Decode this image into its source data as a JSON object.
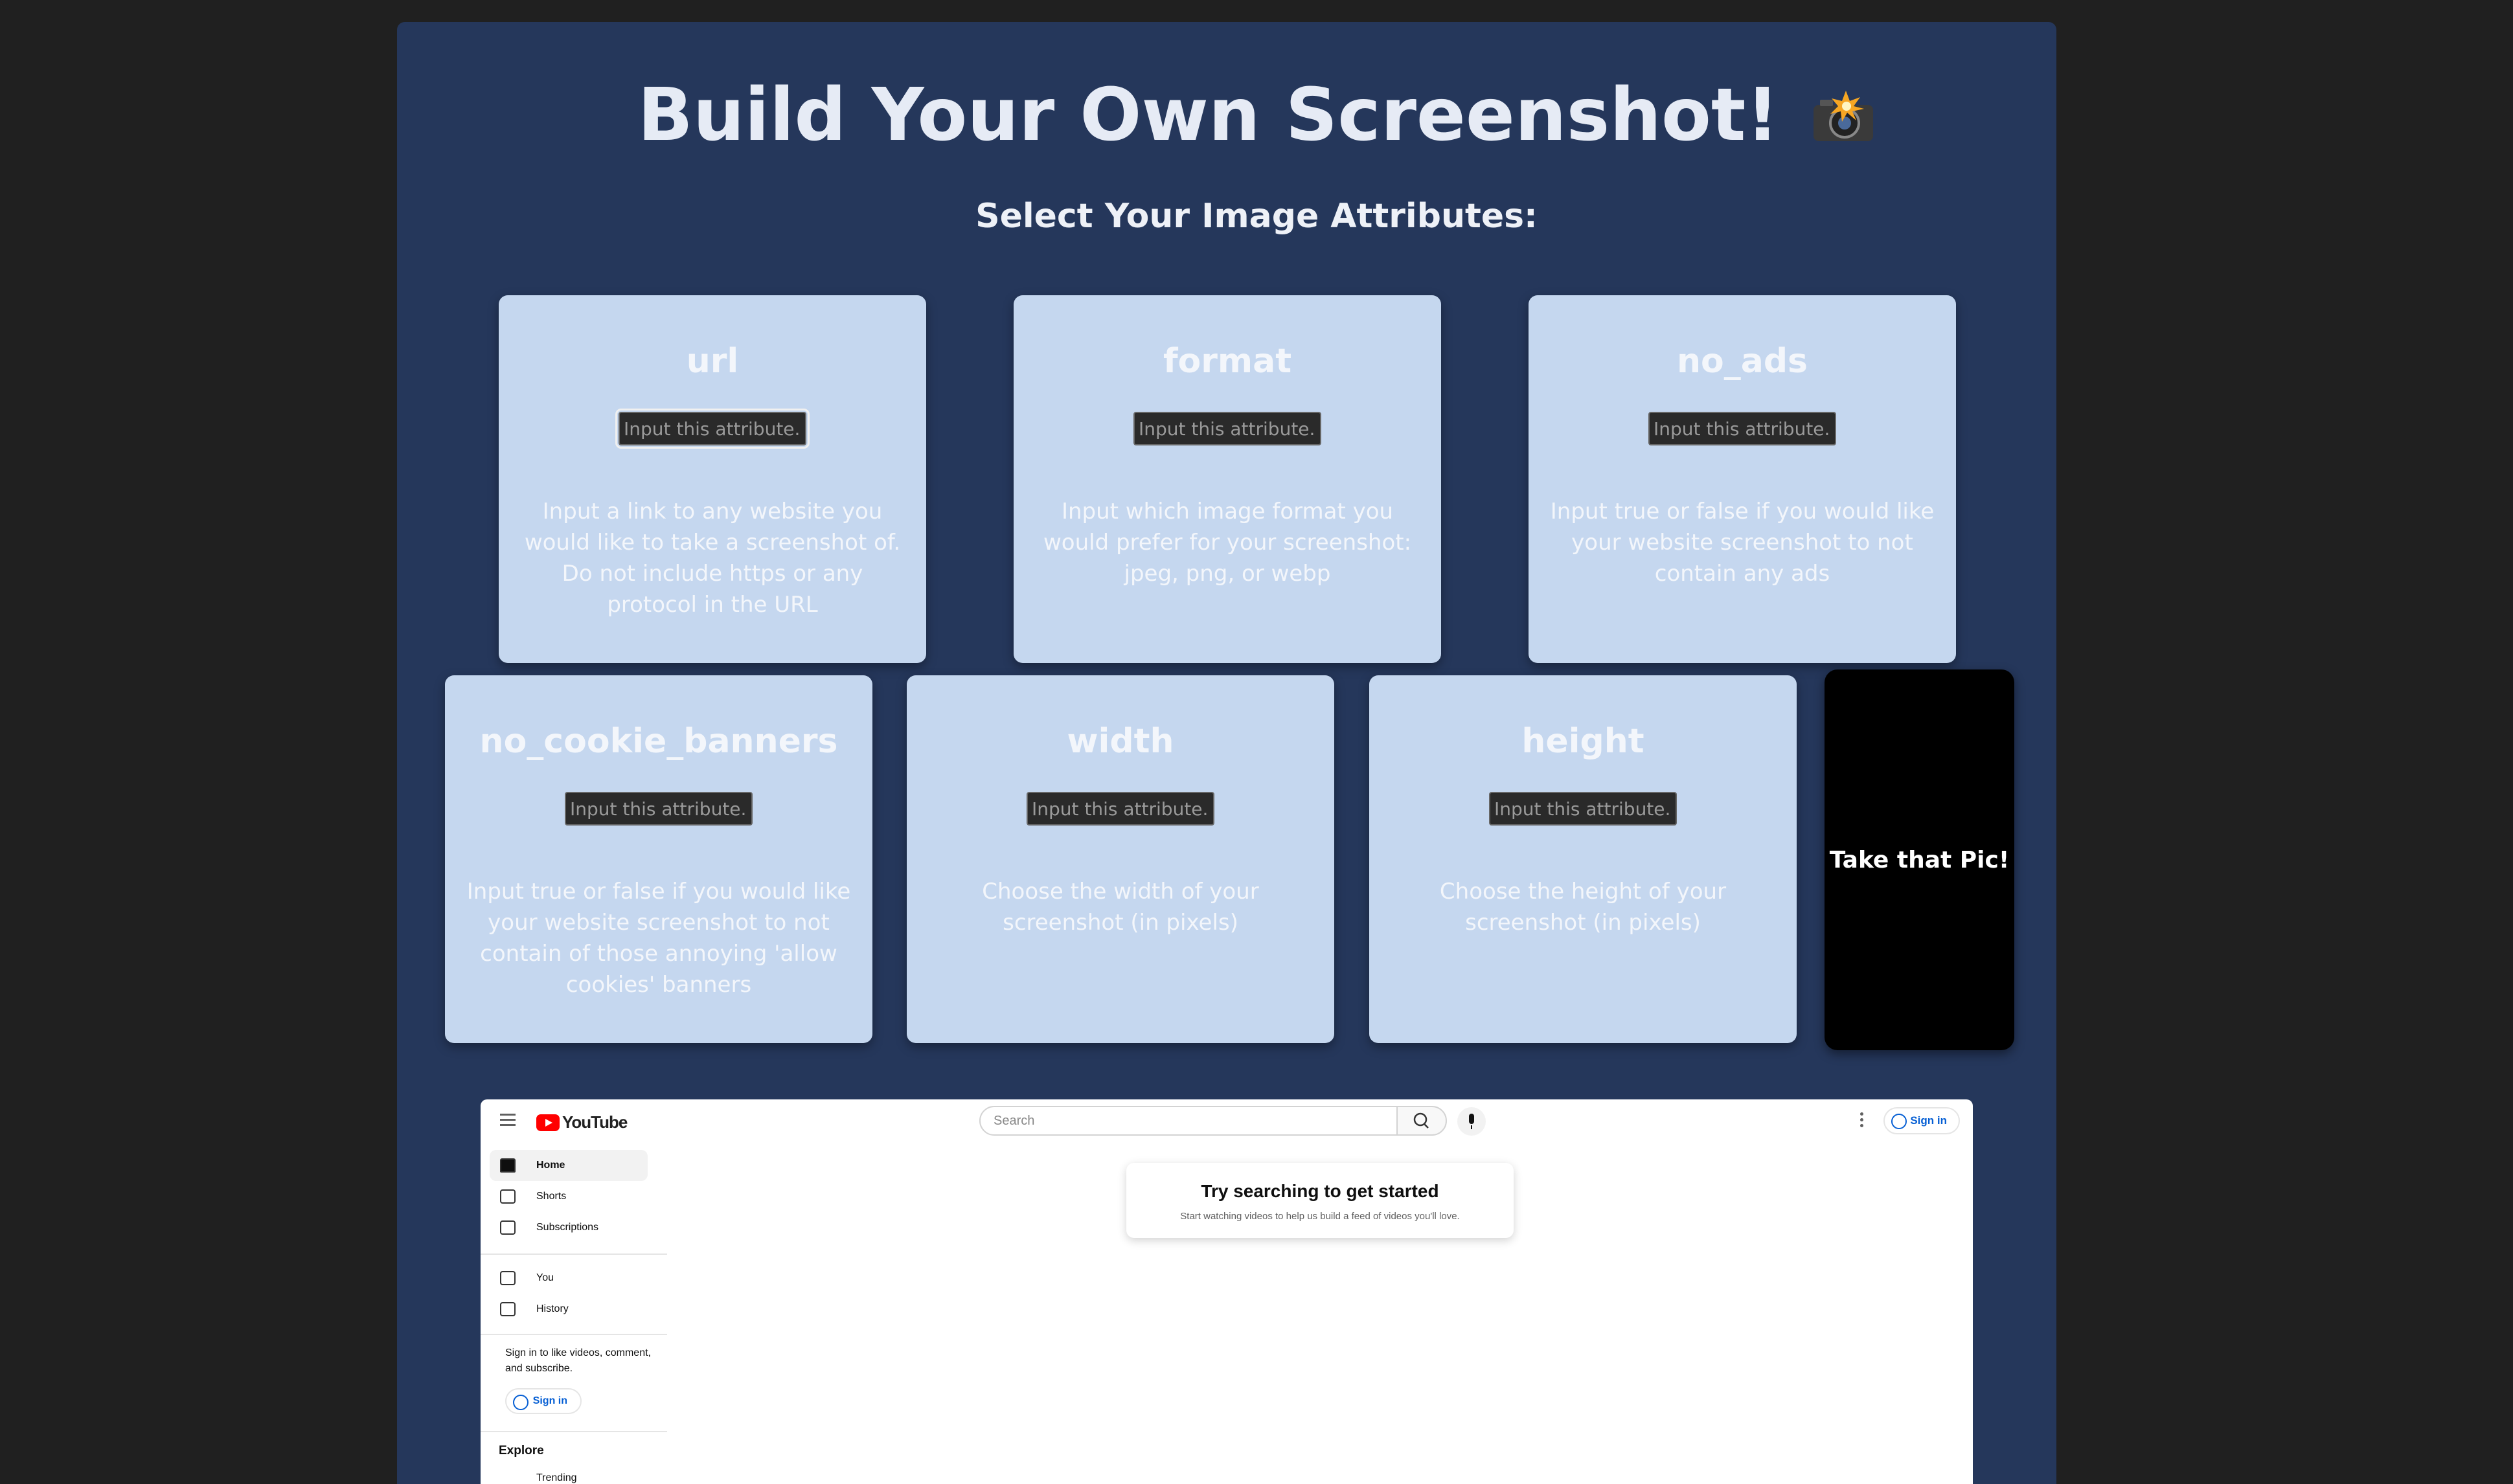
{
  "page": {
    "title": "Build Your Own Screenshot!",
    "subtitle": "Select Your Image Attributes:"
  },
  "cards": [
    {
      "name": "url",
      "placeholder": "Input this attribute...",
      "description": "Input a link to any website you would like to take a screenshot of. Do not include https or any protocol in the URL"
    },
    {
      "name": "format",
      "placeholder": "Input this attribute...",
      "description": "Input which image format you would prefer for your screenshot: jpeg, png, or webp"
    },
    {
      "name": "no_ads",
      "placeholder": "Input this attribute...",
      "description": "Input true or false if you would like your website screenshot to not contain any ads"
    },
    {
      "name": "no_cookie_banners",
      "placeholder": "Input this attribute...",
      "description": "Input true or false if you would like your website screenshot to not contain of those annoying 'allow cookies' banners"
    },
    {
      "name": "width",
      "placeholder": "Input this attribute...",
      "description": "Choose the width of your screenshot (in pixels)"
    },
    {
      "name": "height",
      "placeholder": "Input this attribute...",
      "description": "Choose the height of your screenshot (in pixels)"
    }
  ],
  "action": {
    "label": "Take that Pic!"
  },
  "preview": {
    "logo_text": "YouTube",
    "search_placeholder": "Search",
    "signin_label": "Sign in",
    "sidebar": [
      {
        "label": "Home",
        "icon": "home-icon"
      },
      {
        "label": "Shorts",
        "icon": "shorts-icon"
      },
      {
        "label": "Subscriptions",
        "icon": "subscriptions-icon"
      },
      {
        "label": "You",
        "icon": "you-icon"
      },
      {
        "label": "History",
        "icon": "history-icon"
      }
    ],
    "signin_prompt": "Sign in to like videos, comment, and subscribe.",
    "explore_heading": "Explore",
    "trending_label": "Trending",
    "empty_title": "Try searching to get started",
    "empty_sub": "Start watching videos to help us build a feed of videos you'll love."
  },
  "colors": {
    "panel": "#25375b",
    "card": "#c5d7ef",
    "button": "#000000",
    "background": "#202020"
  }
}
